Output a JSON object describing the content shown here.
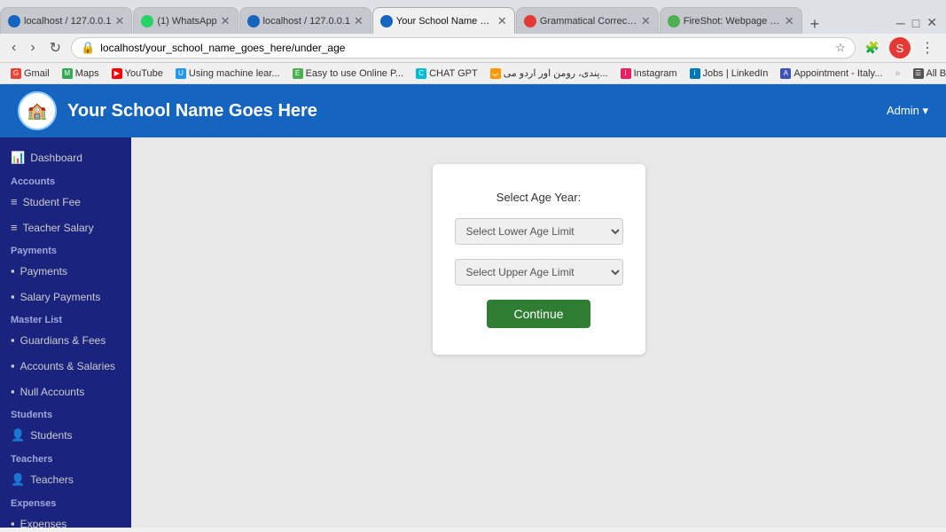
{
  "browser": {
    "tabs": [
      {
        "id": "t1",
        "label": "localhost / 127.0.0.1",
        "favicon_color": "#1565c0",
        "active": false,
        "closeable": true
      },
      {
        "id": "t2",
        "label": "(1) WhatsApp",
        "favicon_color": "#25d366",
        "active": false,
        "closeable": true
      },
      {
        "id": "t3",
        "label": "localhost / 127.0.0.1",
        "favicon_color": "#1565c0",
        "active": false,
        "closeable": true
      },
      {
        "id": "t4",
        "label": "Your School Name G...",
        "favicon_color": "#1565c0",
        "active": true,
        "closeable": true
      },
      {
        "id": "t5",
        "label": "Grammatical Correct...",
        "favicon_color": "#e53935",
        "active": false,
        "closeable": true
      },
      {
        "id": "t6",
        "label": "FireShot: Webpage S...",
        "favicon_color": "#4caf50",
        "active": false,
        "closeable": true
      }
    ],
    "address": "localhost/your_school_name_goes_here/under_age",
    "bookmarks": [
      {
        "label": "Gmail",
        "favicon": "G"
      },
      {
        "label": "Maps",
        "favicon": "M"
      },
      {
        "label": "YouTube",
        "favicon": "▶"
      },
      {
        "label": "Using machine lear...",
        "favicon": "U"
      },
      {
        "label": "Easy to use Online P...",
        "favicon": "E"
      },
      {
        "label": "CHAT GPT",
        "favicon": "C"
      },
      {
        "label": "پندی، رومن اور اردو می...",
        "favicon": "پ"
      },
      {
        "label": "Instagram",
        "favicon": "I"
      },
      {
        "label": "Jobs | LinkedIn",
        "favicon": "in"
      },
      {
        "label": "Appointment - Italy...",
        "favicon": "A"
      },
      {
        "label": "All Bookmarks",
        "favicon": "☰"
      }
    ]
  },
  "header": {
    "school_name": "Your School Name Goes Here",
    "admin_label": "Admin ▾"
  },
  "sidebar": {
    "dashboard_label": "Dashboard",
    "sections": [
      {
        "label": "Accounts",
        "items": [
          {
            "label": "Student Fee",
            "icon": "≡"
          },
          {
            "label": "Teacher Salary",
            "icon": "≡"
          }
        ]
      },
      {
        "label": "Payments",
        "items": [
          {
            "label": "Payments",
            "icon": "▪"
          },
          {
            "label": "Salary Payments",
            "icon": "▪"
          }
        ]
      },
      {
        "label": "Master List",
        "items": [
          {
            "label": "Guardians & Fees",
            "icon": "▪"
          },
          {
            "label": "Accounts & Salaries",
            "icon": "▪"
          },
          {
            "label": "Null Accounts",
            "icon": "▪"
          }
        ]
      },
      {
        "label": "Students",
        "items": [
          {
            "label": "Students",
            "icon": "👤"
          }
        ]
      },
      {
        "label": "Teachers",
        "items": [
          {
            "label": "Teachers",
            "icon": "👤"
          }
        ]
      },
      {
        "label": "Expenses",
        "items": [
          {
            "label": "Expenses",
            "icon": "▪"
          }
        ]
      }
    ]
  },
  "card": {
    "title": "Select Age Year:",
    "lower_age_placeholder": "Select Lower Age Limit",
    "upper_age_placeholder": "Select Upper Age Limit",
    "continue_label": "Continue"
  }
}
